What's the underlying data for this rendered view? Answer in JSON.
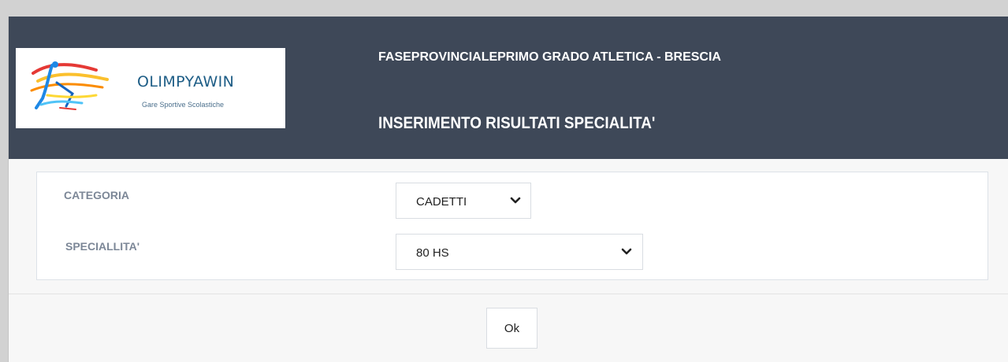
{
  "header": {
    "logo": {
      "brand": "OLIMPYAWIN",
      "tagline": "Gare Sportive Scolastiche"
    },
    "event_title": "FASEPROVINCIALEPRIMO GRADO ATLETICA - BRESCIA",
    "page_title": "INSERIMENTO RISULTATI SPECIALITA'"
  },
  "form": {
    "categoria": {
      "label": "CATEGORIA",
      "selected": "CADETTI",
      "icon": "chevron-down-icon"
    },
    "specialita": {
      "label": "SPECIALLITA'",
      "selected": "80 HS",
      "icon": "chevron-down-icon"
    }
  },
  "footer": {
    "ok_label": "Ok"
  },
  "colors": {
    "header_bg": "#3e4858",
    "page_bg": "#f7f7f7",
    "label": "#7c8797",
    "brand_blue": "#1d5d86"
  }
}
